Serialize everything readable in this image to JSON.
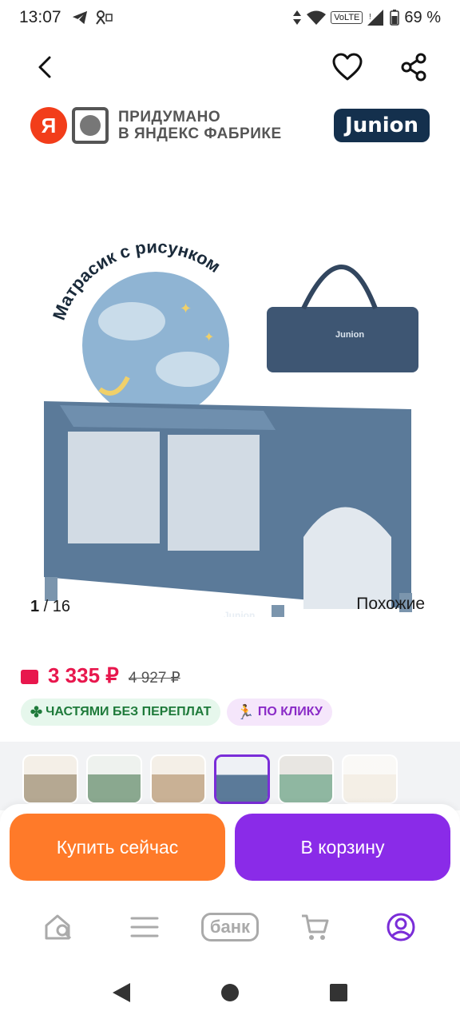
{
  "status_bar": {
    "time": "13:07",
    "volte": "VoLTE",
    "battery": "69 %"
  },
  "brand": {
    "ya_letter": "Я",
    "factory_line1": "ПРИДУМАНО",
    "factory_line2": "В ЯНДЕКС ФАБРИКЕ",
    "partner": "Junion"
  },
  "product_image": {
    "caption": "Матрасик с рисунком",
    "brand_on_item": "Junion"
  },
  "gallery": {
    "current": "1",
    "separator": " / ",
    "total": "16",
    "similar_label": "Похожие"
  },
  "price": {
    "current": "3 335 ₽",
    "old": "4 927 ₽"
  },
  "badges": [
    {
      "label": "ЧАСТЯМИ БЕЗ ПЕРЕПЛАТ",
      "icon": "clover-icon"
    },
    {
      "label": "ПО КЛИКУ",
      "icon": "running-man-icon"
    }
  ],
  "actions": {
    "buy_now": "Купить сейчас",
    "add_to_cart": "В корзину"
  },
  "bottom_nav": {
    "bank_label": "банк"
  },
  "colors": {
    "price": "#e8174d",
    "buy_button": "#ff7a29",
    "cart_button": "#8a2be8",
    "accent_purple": "#7a2dd8"
  }
}
